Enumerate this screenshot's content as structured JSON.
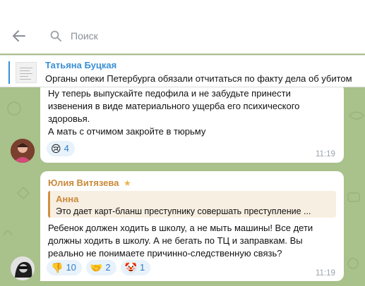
{
  "top": {
    "cut_title": "Tатьяна Буцкая"
  },
  "search": {
    "placeholder": "Поиск"
  },
  "pinned": {
    "name": "Татьяна Буцкая",
    "text": "Органы опеки Петербурга обязали отчитаться по факту дела об убитом"
  },
  "messages": [
    {
      "text_lines": [
        "Ну теперь выпускайте педофила и не забудьте принести",
        "извенения в виде материального ущерба его психического",
        "здоровья.",
        "А мать с отчимом закройте в тюрьму"
      ],
      "reactions": [
        {
          "icon": "crying-face",
          "emoji": "😢",
          "count": "4"
        }
      ],
      "time": "11:19"
    },
    {
      "sender": "Юлия Витязева",
      "reply": {
        "name": "Анна",
        "text": "Это дает карт-бланш преступнику совершать преступление ..."
      },
      "text_lines": [
        "Ребенок должен ходить в школу, а не мыть машины! Все дети",
        "должны ходить в школу. А не бегать по ТЦ и заправкам. Вы",
        "реально не понимаете причинно-следственную связь?"
      ],
      "reactions": [
        {
          "icon": "thumbs-down",
          "emoji": "👎",
          "count": "10"
        },
        {
          "icon": "handshake",
          "emoji": "🤝",
          "count": "2"
        },
        {
          "icon": "clown-face",
          "emoji": "🤡",
          "count": "1"
        }
      ],
      "time": "11:19"
    }
  ],
  "colors": {
    "accent_blue": "#3a8fd6",
    "sender_orange": "#c98a3a",
    "chat_background": "#a9c18a"
  }
}
